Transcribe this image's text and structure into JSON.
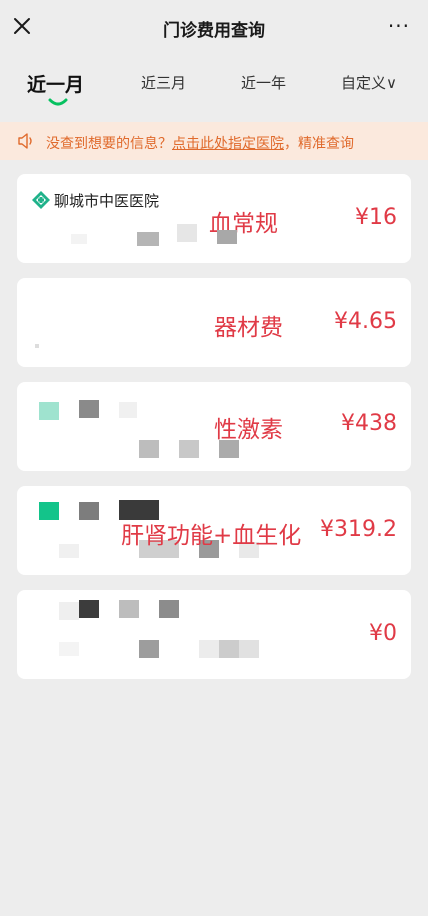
{
  "nav": {
    "title": "门诊费用查询",
    "more": "···"
  },
  "tabs": [
    {
      "label": "近一月",
      "active": true
    },
    {
      "label": "近三月",
      "active": false
    },
    {
      "label": "近一年",
      "active": false
    },
    {
      "label": "自定义∨",
      "active": false
    }
  ],
  "notice": {
    "icon": "speaker-icon",
    "prefix": "没查到想要的信息？",
    "link": "点击此处指定医院",
    "suffix": "，精准查询"
  },
  "records": [
    {
      "hospital": "聊城市中医医院",
      "item": "血常规",
      "amount": "¥16"
    },
    {
      "hospital": "",
      "item": "器材费",
      "amount": "¥4.65"
    },
    {
      "hospital": "",
      "item": "性激素",
      "amount": "¥438"
    },
    {
      "hospital": "",
      "item": "肝肾功能+血生化",
      "amount": "¥319.2"
    },
    {
      "hospital": "",
      "item": "",
      "amount": "¥0"
    }
  ],
  "colors": {
    "accent": "#07c160",
    "notice_text": "#e06a2c",
    "notice_bg": "#fbe9dd",
    "annotation": "#e03a46"
  }
}
